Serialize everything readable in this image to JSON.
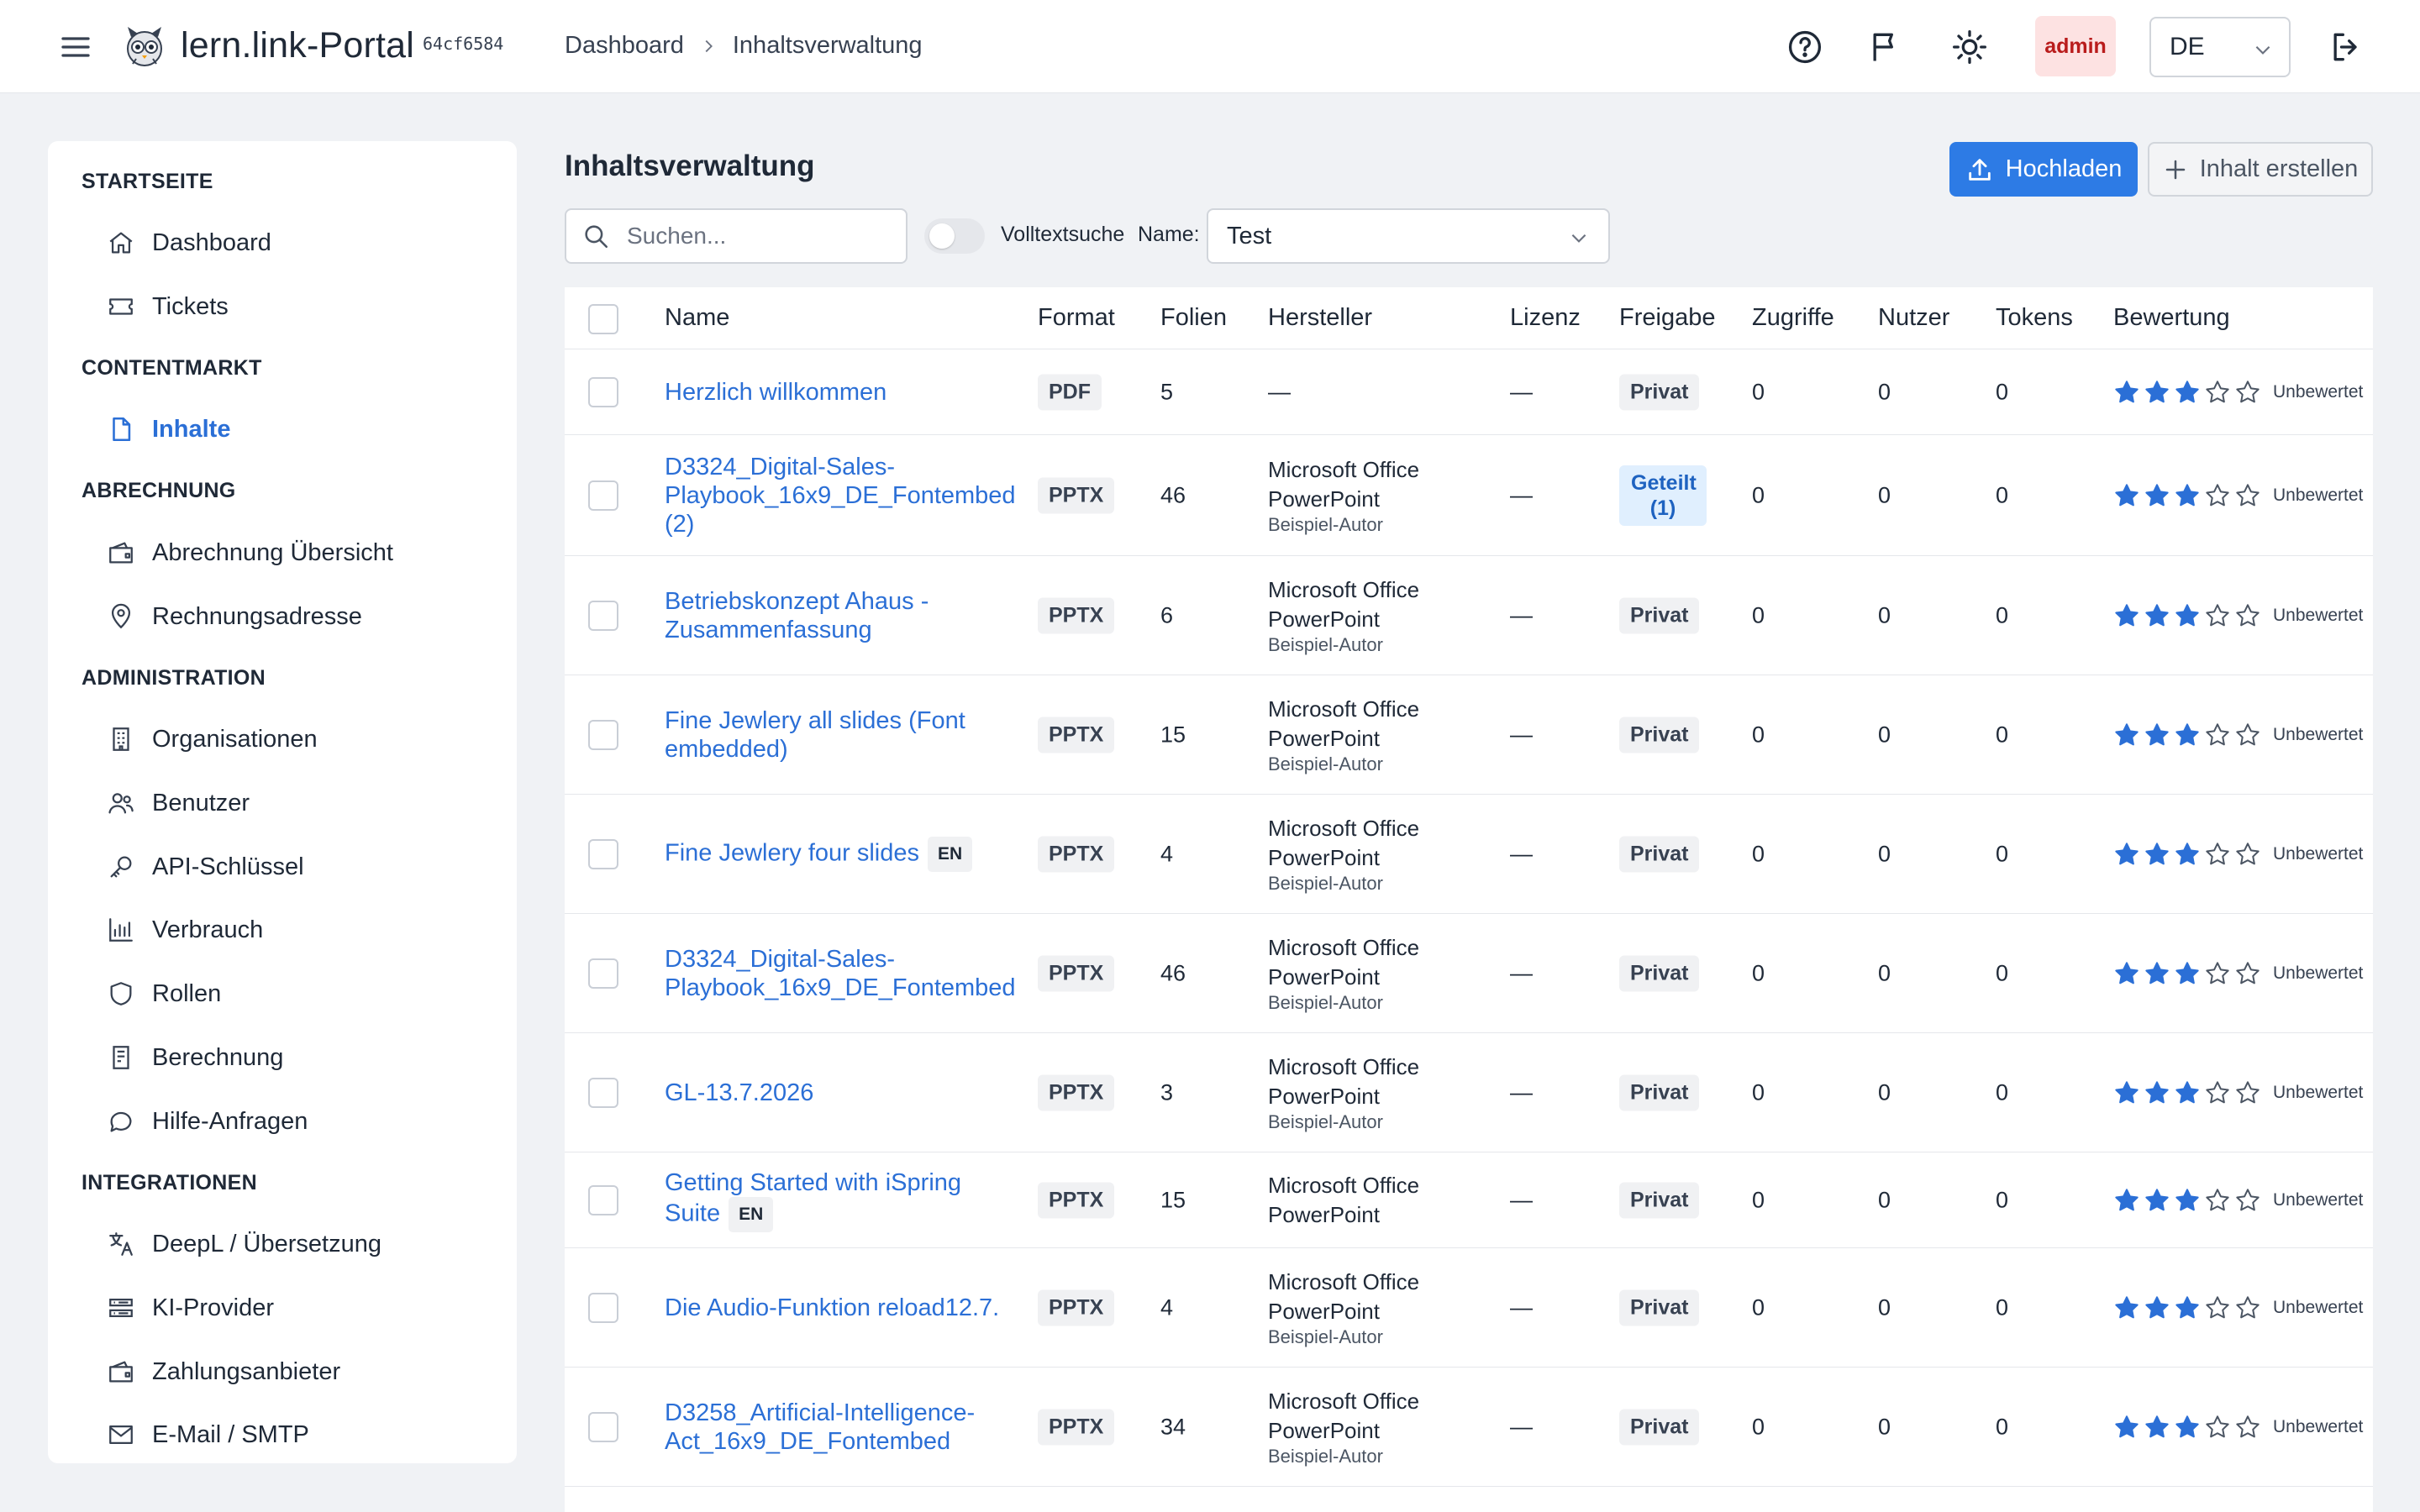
{
  "header": {
    "app_name": "lern.link-Portal",
    "version": "64cf6584",
    "breadcrumb": [
      "Dashboard",
      "Inhaltsverwaltung"
    ],
    "user_badge": "admin",
    "language": "DE"
  },
  "sidebar": {
    "sections": [
      {
        "title": "STARTSEITE",
        "items": [
          {
            "label": "Dashboard",
            "icon": "home-icon"
          },
          {
            "label": "Tickets",
            "icon": "ticket-icon"
          }
        ]
      },
      {
        "title": "CONTENTMARKT",
        "items": [
          {
            "label": "Inhalte",
            "icon": "document-icon",
            "active": true
          }
        ]
      },
      {
        "title": "ABRECHNUNG",
        "items": [
          {
            "label": "Abrechnung Übersicht",
            "icon": "wallet-icon"
          },
          {
            "label": "Rechnungsadresse",
            "icon": "map-pin-icon"
          }
        ]
      },
      {
        "title": "ADMINISTRATION",
        "items": [
          {
            "label": "Organisationen",
            "icon": "building-icon"
          },
          {
            "label": "Benutzer",
            "icon": "users-icon"
          },
          {
            "label": "API-Schlüssel",
            "icon": "key-icon"
          },
          {
            "label": "Verbrauch",
            "icon": "bar-chart-icon"
          },
          {
            "label": "Rollen",
            "icon": "shield-icon"
          },
          {
            "label": "Berechnung",
            "icon": "receipt-icon"
          },
          {
            "label": "Hilfe-Anfragen",
            "icon": "chat-icon"
          }
        ]
      },
      {
        "title": "INTEGRATIONEN",
        "items": [
          {
            "label": "DeepL / Übersetzung",
            "icon": "translate-icon"
          },
          {
            "label": "KI-Provider",
            "icon": "server-icon"
          },
          {
            "label": "Zahlungsanbieter",
            "icon": "wallet-icon"
          },
          {
            "label": "E-Mail / SMTP",
            "icon": "mail-icon"
          }
        ]
      }
    ]
  },
  "main": {
    "title": "Inhaltsverwaltung",
    "upload_button": "Hochladen",
    "create_button": "Inhalt erstellen",
    "search_placeholder": "Suchen...",
    "fulltext_label": "Volltextsuche",
    "fulltext_enabled": false,
    "name_filter_label": "Name:",
    "name_filter_value": "Test"
  },
  "table": {
    "columns": [
      "Name",
      "Format",
      "Folien",
      "Hersteller",
      "Lizenz",
      "Freigabe",
      "Zugriffe",
      "Nutzer",
      "Tokens",
      "Bewertung"
    ],
    "rows": [
      {
        "name": "Herzlich willkommen",
        "lang": "",
        "format": "PDF",
        "slides": "5",
        "maker": "—",
        "author": "",
        "license": "—",
        "share": "Privat",
        "shared": false,
        "hits": "0",
        "users": "0",
        "tokens": "0",
        "stars": 3,
        "rating_label": "Unbewertet"
      },
      {
        "name": "D3324_Digital-Sales-Playbook_16x9_DE_Fontembed (2)",
        "lang": "",
        "format": "PPTX",
        "slides": "46",
        "maker": "Microsoft Office PowerPoint",
        "author": "Beispiel-Autor",
        "license": "—",
        "share": "Geteilt (1)",
        "shared": true,
        "hits": "0",
        "users": "0",
        "tokens": "0",
        "stars": 3,
        "rating_label": "Unbewertet"
      },
      {
        "name": "Betriebskonzept Ahaus - Zusammenfassung",
        "lang": "",
        "format": "PPTX",
        "slides": "6",
        "maker": "Microsoft Office PowerPoint",
        "author": "Beispiel-Autor",
        "license": "—",
        "share": "Privat",
        "shared": false,
        "hits": "0",
        "users": "0",
        "tokens": "0",
        "stars": 3,
        "rating_label": "Unbewertet"
      },
      {
        "name": "Fine Jewlery all slides (Font embedded)",
        "lang": "",
        "format": "PPTX",
        "slides": "15",
        "maker": "Microsoft Office PowerPoint",
        "author": "Beispiel-Autor",
        "license": "—",
        "share": "Privat",
        "shared": false,
        "hits": "0",
        "users": "0",
        "tokens": "0",
        "stars": 3,
        "rating_label": "Unbewertet"
      },
      {
        "name": "Fine Jewlery four slides",
        "lang": "EN",
        "format": "PPTX",
        "slides": "4",
        "maker": "Microsoft Office PowerPoint",
        "author": "Beispiel-Autor",
        "license": "—",
        "share": "Privat",
        "shared": false,
        "hits": "0",
        "users": "0",
        "tokens": "0",
        "stars": 3,
        "rating_label": "Unbewertet"
      },
      {
        "name": "D3324_Digital-Sales-Playbook_16x9_DE_Fontembed",
        "lang": "",
        "format": "PPTX",
        "slides": "46",
        "maker": "Microsoft Office PowerPoint",
        "author": "Beispiel-Autor",
        "license": "—",
        "share": "Privat",
        "shared": false,
        "hits": "0",
        "users": "0",
        "tokens": "0",
        "stars": 3,
        "rating_label": "Unbewertet"
      },
      {
        "name": "GL-13.7.2026",
        "lang": "",
        "format": "PPTX",
        "slides": "3",
        "maker": "Microsoft Office PowerPoint",
        "author": "Beispiel-Autor",
        "license": "—",
        "share": "Privat",
        "shared": false,
        "hits": "0",
        "users": "0",
        "tokens": "0",
        "stars": 3,
        "rating_label": "Unbewertet"
      },
      {
        "name": "Getting Started with iSpring Suite",
        "lang": "EN",
        "format": "PPTX",
        "slides": "15",
        "maker": "Microsoft Office PowerPoint",
        "author": "",
        "license": "—",
        "share": "Privat",
        "shared": false,
        "hits": "0",
        "users": "0",
        "tokens": "0",
        "stars": 3,
        "rating_label": "Unbewertet"
      },
      {
        "name": "Die Audio-Funktion reload12.7.",
        "lang": "",
        "format": "PPTX",
        "slides": "4",
        "maker": "Microsoft Office PowerPoint",
        "author": "Beispiel-Autor",
        "license": "—",
        "share": "Privat",
        "shared": false,
        "hits": "0",
        "users": "0",
        "tokens": "0",
        "stars": 3,
        "rating_label": "Unbewertet"
      },
      {
        "name": "D3258_Artificial-Intelligence-Act_16x9_DE_Fontembed",
        "lang": "",
        "format": "PPTX",
        "slides": "34",
        "maker": "Microsoft Office PowerPoint",
        "author": "Beispiel-Autor",
        "license": "—",
        "share": "Privat",
        "shared": false,
        "hits": "0",
        "users": "0",
        "tokens": "0",
        "stars": 3,
        "rating_label": "Unbewertet"
      }
    ]
  },
  "colors": {
    "accent": "#2d7be5",
    "link": "#2b6fd6",
    "star": "#2b6fd6",
    "admin_bg": "#fde2e2",
    "admin_text": "#b91c1c"
  }
}
